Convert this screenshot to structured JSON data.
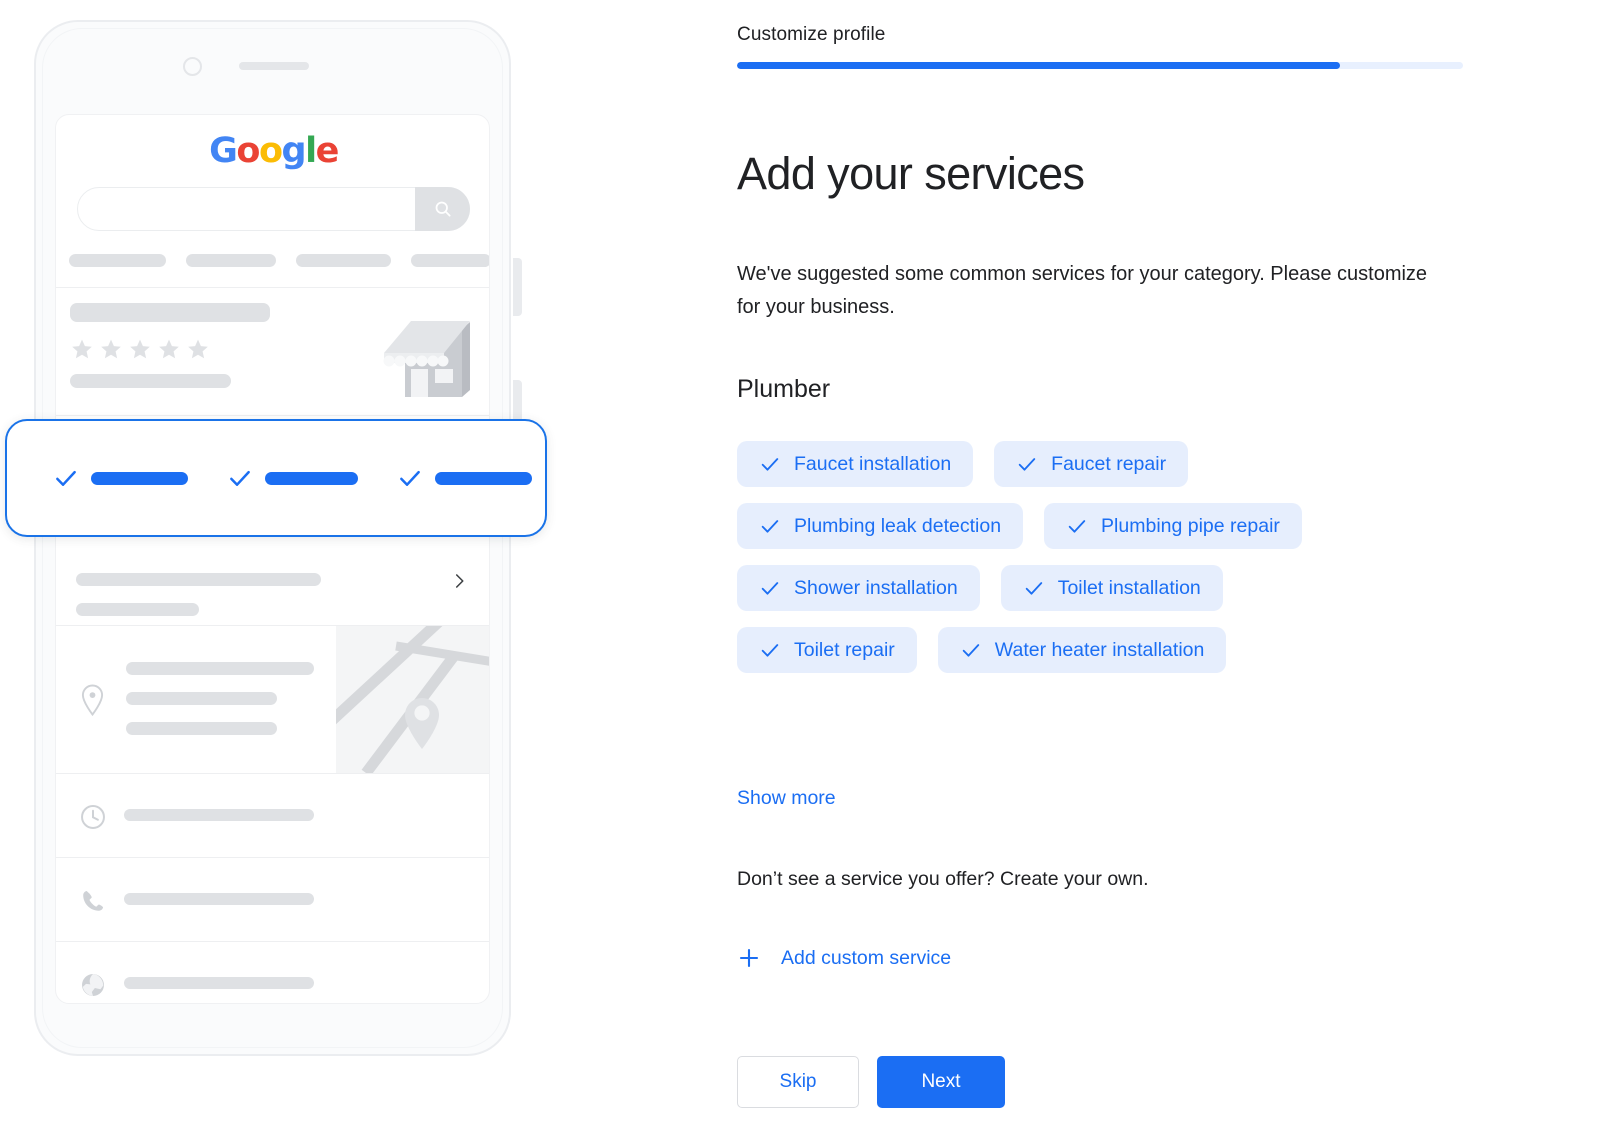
{
  "step": {
    "label": "Customize profile",
    "progress_percent": 83,
    "accent_color": "#1b6ef3",
    "track_color": "#e8f0fe"
  },
  "main": {
    "headline": "Add your services",
    "subtext": "We've suggested some common services for your category. Please customize for your business.",
    "category": "Plumber",
    "service_rows": [
      [
        "Faucet installation",
        "Faucet repair"
      ],
      [
        "Plumbing leak detection",
        "Plumbing pipe repair"
      ],
      [
        "Shower installation",
        "Toilet installation"
      ],
      [
        "Toilet repair",
        "Water heater installation"
      ]
    ],
    "show_more_label": "Show more",
    "create_own_text": "Don’t see a service you offer? Create your own.",
    "add_custom_label": "Add custom service",
    "chip_bg_color": "#e6eefd",
    "chip_text_color": "#1b6ef3"
  },
  "actions": {
    "skip_label": "Skip",
    "next_label": "Next"
  },
  "illustration": {
    "logo": {
      "letters": [
        {
          "char": "G",
          "color": "#4285f4"
        },
        {
          "char": "o",
          "color": "#ea4335"
        },
        {
          "char": "o",
          "color": "#fbbc05"
        },
        {
          "char": "g",
          "color": "#4285f4"
        },
        {
          "char": "l",
          "color": "#34a853"
        },
        {
          "char": "e",
          "color": "#ea4335"
        }
      ]
    },
    "placeholder_color": "#dfe1e4",
    "highlight_color": "#1b6ef3",
    "chip_row_widths": [
      95,
      90,
      95,
      95
    ],
    "callout_bar_widths": [
      97,
      93,
      97
    ],
    "icon_rows": [
      "clock-icon",
      "phone-icon",
      "globe-icon"
    ]
  }
}
